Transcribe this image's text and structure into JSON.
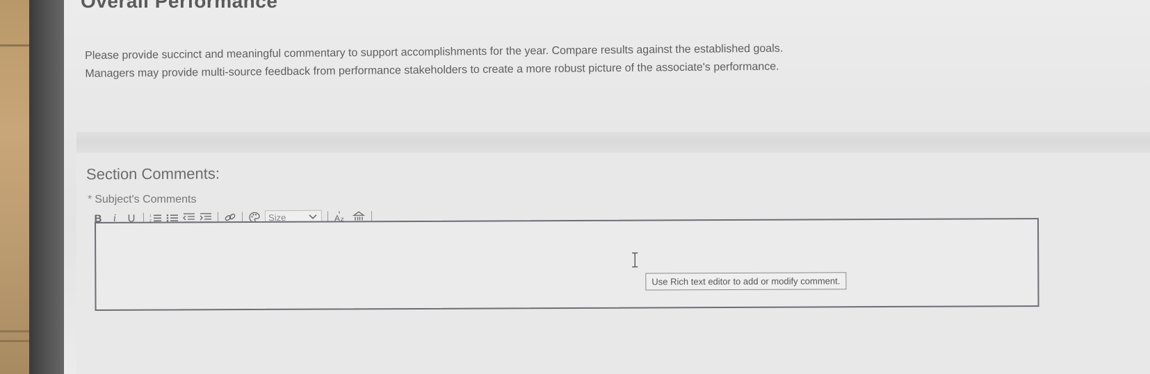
{
  "page": {
    "section_title": "Overall Performance",
    "intro_lines": [
      "Please provide succinct and meaningful commentary to support accomplishments for the year.  Compare results against the established goals.",
      "Managers may provide multi-source feedback from performance stakeholders to create a more robust picture of the associate's performance."
    ],
    "section_comments_heading": "Section Comments:",
    "field": {
      "required_marker": "*",
      "label": "Subject's Comments"
    }
  },
  "toolbar": {
    "bold_label": "B",
    "italic_label": "i",
    "underline_label": "U",
    "icons": [
      "numbered-list-icon",
      "bulleted-list-icon",
      "outdent-icon",
      "indent-icon",
      "link-icon",
      "color-palette-icon",
      "chevron-down-icon",
      "font-size-icon",
      "clear-format-icon"
    ],
    "font_size": {
      "selected": "Size"
    }
  },
  "editor": {
    "value": "",
    "tooltip": "Use Rich text editor to add or modify comment."
  },
  "colors": {
    "screen_bg": "#e7e7e7",
    "text_primary": "#5e5e5e",
    "editor_border": "#6c6c74",
    "desk": "#c9a679"
  }
}
